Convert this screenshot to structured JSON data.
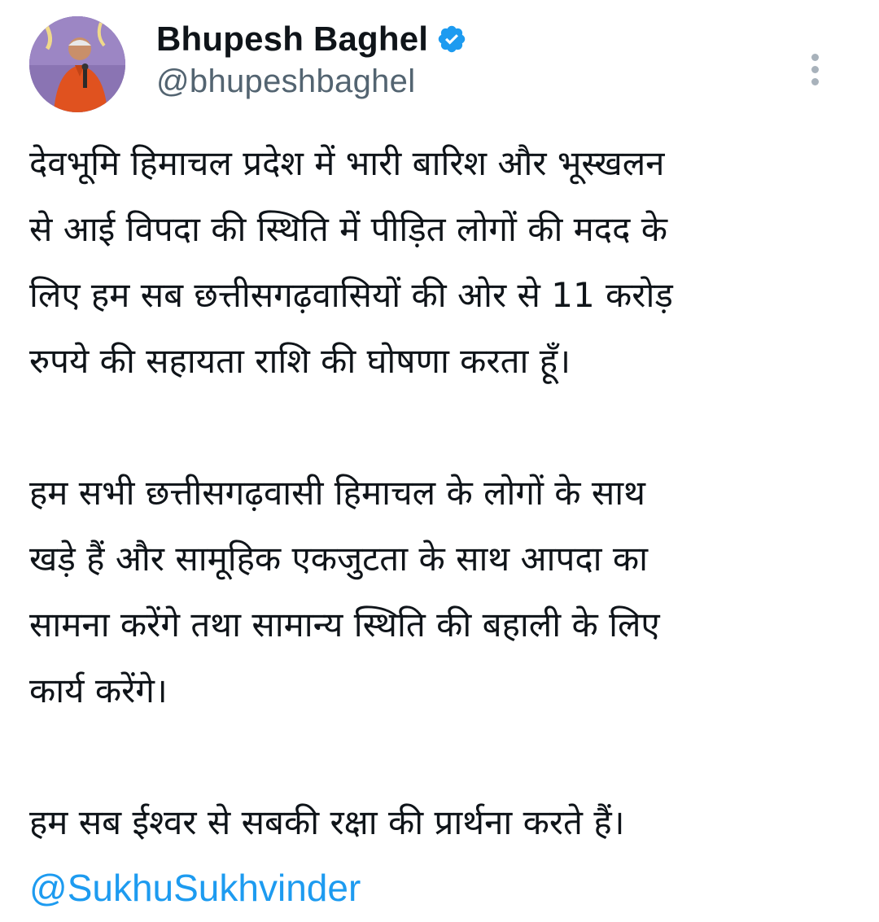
{
  "tweet": {
    "author": {
      "display_name": "Bhupesh Baghel",
      "handle": "@bhupeshbaghel",
      "verified_icon": "verified-badge-icon",
      "avatar": "avatar"
    },
    "paragraphs": [
      "देवभूमि हिमाचल प्रदेश में भारी बारिश और भूस्खलन\nसे आई विपदा की स्थिति में पीड़ित लोगों की मदद के\nलिए हम सब छत्तीसगढ़वासियों की ओर से 11 करोड़\nरुपये की सहायता राशि की घोषणा करता हूँ।",
      "हम सभी छत्तीसगढ़वासी हिमाचल के लोगों के साथ\nखड़े हैं और सामूहिक एकजुटता के साथ आपदा का\nसामना करेंगे तथा सामान्य स्थिति की बहाली के लिए\nकार्य करेंगे।",
      "हम सब ईश्वर से सबकी रक्षा की प्रार्थना करते हैं।"
    ],
    "mention": "@SukhuSukhvinder",
    "more_icon": "more-vertical-icon"
  },
  "colors": {
    "text": "#0f1419",
    "secondary": "#536471",
    "link": "#1d9bf0",
    "verified": "#1d9bf0"
  }
}
